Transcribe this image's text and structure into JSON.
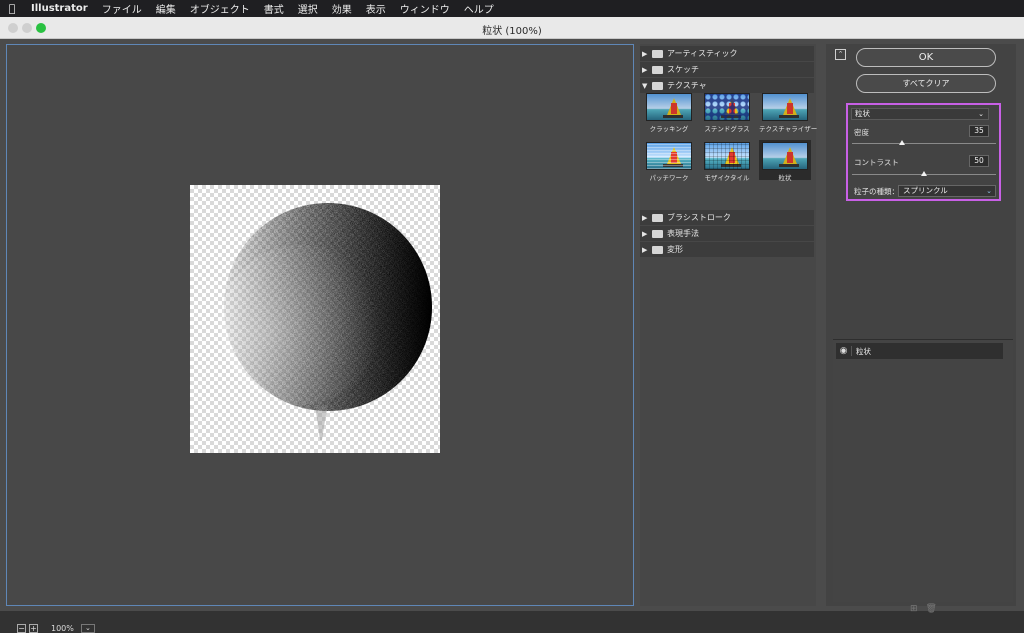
{
  "menubar": {
    "apple_icon": "",
    "app": "Illustrator",
    "items": [
      "ファイル",
      "編集",
      "オブジェクト",
      "書式",
      "選択",
      "効果",
      "表示",
      "ウィンドウ",
      "ヘルプ"
    ]
  },
  "window": {
    "title": "粒状 (100%)"
  },
  "preview": {
    "zoom": "100%",
    "zoom_out": "−",
    "zoom_in": "+"
  },
  "gallery": {
    "folders": [
      {
        "label": "アーティスティック",
        "expanded": false
      },
      {
        "label": "スケッチ",
        "expanded": false
      },
      {
        "label": "テクスチャ",
        "expanded": true
      },
      {
        "label": "ブラシストローク",
        "expanded": false
      },
      {
        "label": "表現手法",
        "expanded": false
      },
      {
        "label": "変形",
        "expanded": false
      }
    ],
    "texture_filters": [
      {
        "label": "クラッキング"
      },
      {
        "label": "ステンドグラス"
      },
      {
        "label": "テクスチャライザー"
      },
      {
        "label": "パッチワーク"
      },
      {
        "label": "モザイクタイル"
      },
      {
        "label": "粒状",
        "selected": true
      }
    ]
  },
  "panel": {
    "collapse_icon": "⌃",
    "ok_label": "OK",
    "clear_label": "すべてクリア",
    "filter_select": "粒状",
    "density_label": "密度",
    "density_value": "35",
    "contrast_label": "コントラスト",
    "contrast_value": "50",
    "particle_type_label": "粒子の種類：",
    "particle_type_value": "スプリンクル",
    "density_fraction": 0.35,
    "contrast_fraction": 0.5
  },
  "layers": {
    "row_label": "粒状"
  },
  "colors": {
    "highlight_border": "#c860e6",
    "preview_border": "#5f87b7",
    "maximize": "#29c141"
  }
}
